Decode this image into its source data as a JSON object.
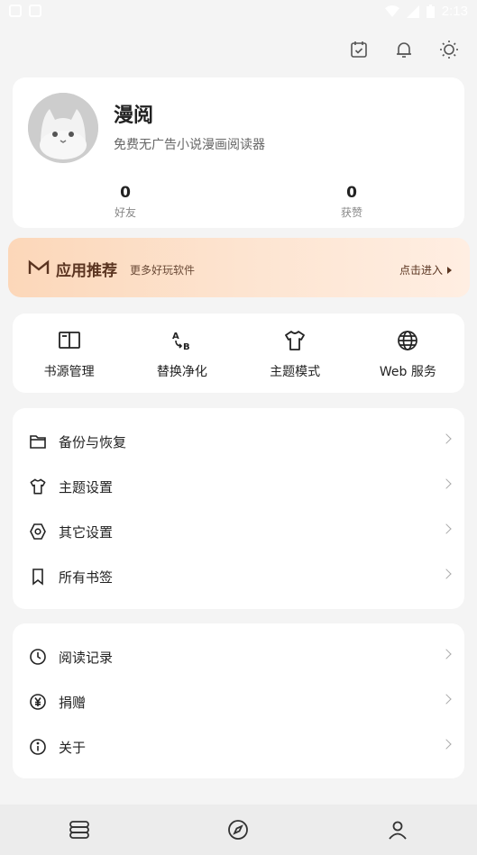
{
  "status_bar": {
    "time": "2:13"
  },
  "top_icons": [
    "calendar-check-icon",
    "bell-icon",
    "sun-icon"
  ],
  "profile": {
    "name": "漫阅",
    "description": "免费无广告小说漫画阅读器",
    "friends_count": "0",
    "friends_label": "好友",
    "likes_count": "0",
    "likes_label": "获赞"
  },
  "banner": {
    "title": "应用推荐",
    "subtitle": "更多好玩软件",
    "action": "点击进入"
  },
  "quick_actions": [
    {
      "label": "书源管理",
      "icon": "book-open-icon"
    },
    {
      "label": "替换净化",
      "icon": "replace-ab-icon"
    },
    {
      "label": "主题模式",
      "icon": "tshirt-icon"
    },
    {
      "label": "Web 服务",
      "icon": "globe-icon"
    }
  ],
  "settings_group_1": [
    {
      "label": "备份与恢复",
      "icon": "folder-icon"
    },
    {
      "label": "主题设置",
      "icon": "tshirt-icon"
    },
    {
      "label": "其它设置",
      "icon": "hexagon-settings-icon"
    },
    {
      "label": "所有书签",
      "icon": "bookmark-icon"
    }
  ],
  "settings_group_2": [
    {
      "label": "阅读记录",
      "icon": "clock-icon"
    },
    {
      "label": "捐赠",
      "icon": "yen-icon"
    },
    {
      "label": "关于",
      "icon": "info-icon"
    }
  ],
  "bottom_nav": [
    {
      "icon": "bookshelf-icon"
    },
    {
      "icon": "compass-icon"
    },
    {
      "icon": "profile-icon"
    }
  ],
  "colors": {
    "background": "#f4f4f4",
    "card": "#ffffff",
    "banner_start": "#fcd7b9",
    "banner_text": "#5a3420"
  }
}
